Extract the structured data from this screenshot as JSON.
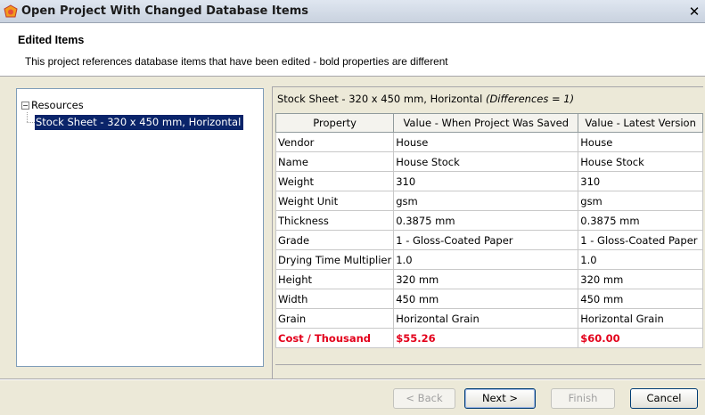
{
  "window": {
    "title": "Open Project With Changed Database Items",
    "close_glyph": "✕"
  },
  "header": {
    "title": "Edited Items",
    "description": "This project references database items that have been edited - bold properties are different"
  },
  "tree": {
    "root_expander": "−",
    "root_label": "Resources",
    "child_label": "Stock Sheet - 320 x 450 mm, Horizontal"
  },
  "details": {
    "caption_main": "Stock Sheet - 320 x 450 mm, Horizontal",
    "caption_diff": "(Differences = 1)",
    "columns": [
      "Property",
      "Value - When Project Was Saved",
      "Value - Latest Version"
    ],
    "rows": [
      [
        "Vendor",
        "House",
        "House"
      ],
      [
        "Name",
        "House Stock",
        "House Stock"
      ],
      [
        "Weight",
        "310",
        "310"
      ],
      [
        "Weight Unit",
        "gsm",
        "gsm"
      ],
      [
        "Thickness",
        "0.3875 mm",
        "0.3875 mm"
      ],
      [
        "Grade",
        "1 - Gloss-Coated Paper",
        "1 - Gloss-Coated Paper"
      ],
      [
        "Drying Time Multiplier",
        "1.0",
        "1.0"
      ],
      [
        "Height",
        "320 mm",
        "320 mm"
      ],
      [
        "Width",
        "450 mm",
        "450 mm"
      ],
      [
        "Grain",
        "Horizontal Grain",
        "Horizontal Grain"
      ],
      [
        "Cost / Thousand",
        "$55.26",
        "$60.00"
      ]
    ],
    "diff_color": "#e3001b"
  },
  "buttons": {
    "back": "< Back",
    "next": "Next >",
    "finish": "Finish",
    "cancel": "Cancel"
  }
}
